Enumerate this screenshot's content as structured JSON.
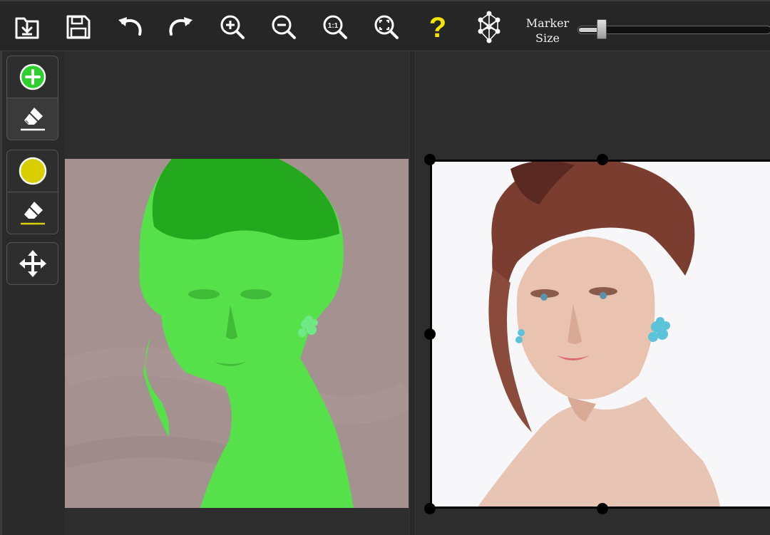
{
  "toolbar": {
    "buttons": [
      {
        "name": "open-file",
        "icon": "folder-download-icon"
      },
      {
        "name": "save",
        "icon": "floppy-disk-icon"
      },
      {
        "name": "undo",
        "icon": "undo-arrow-icon"
      },
      {
        "name": "redo",
        "icon": "redo-arrow-icon"
      },
      {
        "name": "zoom-in",
        "icon": "zoom-in-icon"
      },
      {
        "name": "zoom-out",
        "icon": "zoom-out-icon"
      },
      {
        "name": "zoom-actual",
        "icon": "zoom-1to1-icon",
        "label": "1:1"
      },
      {
        "name": "zoom-fit",
        "icon": "zoom-fit-icon"
      },
      {
        "name": "help",
        "icon": "question-mark-icon",
        "label": "?"
      },
      {
        "name": "neural-process",
        "icon": "neural-network-icon"
      }
    ],
    "marker_size": {
      "label_line1": "Marker",
      "label_line2": "Size",
      "value": 0.08
    }
  },
  "sidebar": {
    "foreground_tools": [
      {
        "name": "add-foreground",
        "icon": "plus-circle-icon"
      },
      {
        "name": "erase-foreground",
        "icon": "eraser-icon",
        "selected": true
      }
    ],
    "background_tools": [
      {
        "name": "add-background",
        "icon": "yellow-circle-icon"
      },
      {
        "name": "erase-background",
        "icon": "eraser-icon"
      }
    ],
    "move_tool": {
      "name": "move",
      "icon": "move-arrows-icon"
    }
  },
  "colors": {
    "foreground_marker": "#2fd12f",
    "background_marker": "#d9cf00",
    "help_icon": "#f5e400",
    "canvas": "#2d2d2d",
    "left_background": "#a49190"
  }
}
